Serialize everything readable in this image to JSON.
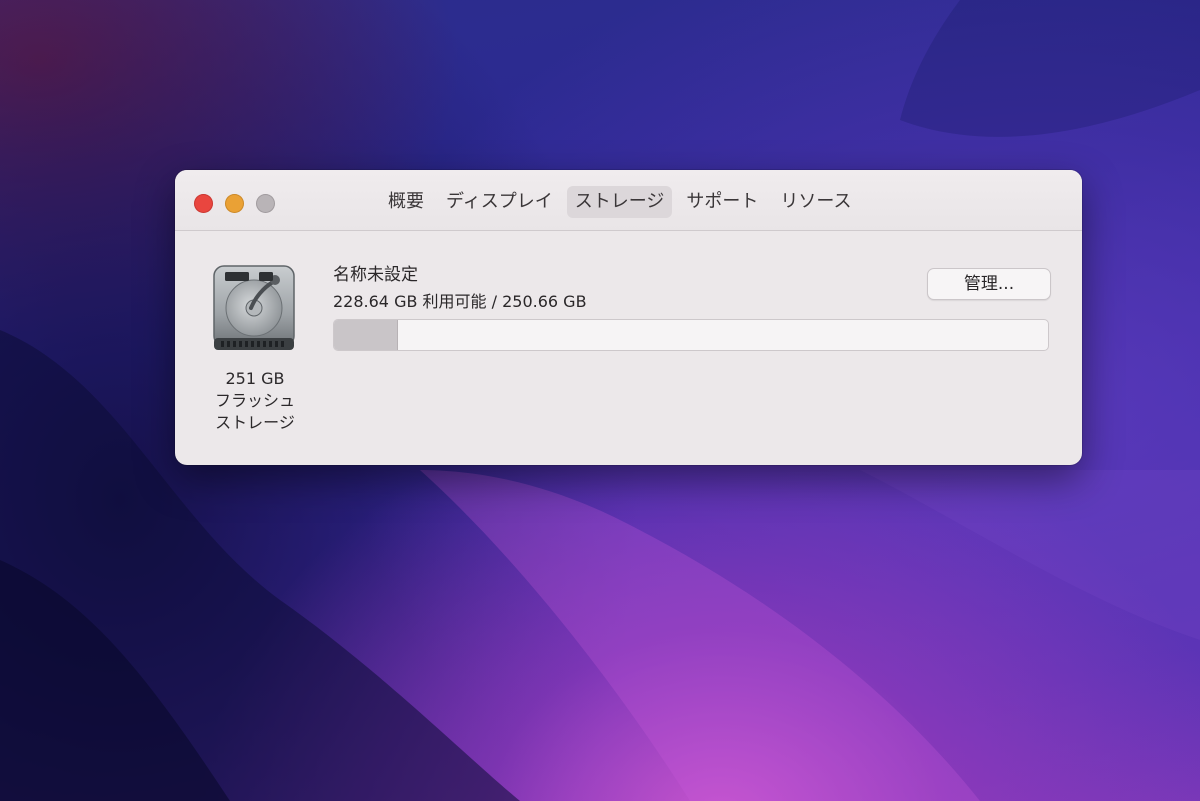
{
  "window": {
    "tabs": [
      {
        "label": "概要",
        "selected": false
      },
      {
        "label": "ディスプレイ",
        "selected": false
      },
      {
        "label": "ストレージ",
        "selected": true
      },
      {
        "label": "サポート",
        "selected": false
      },
      {
        "label": "リソース",
        "selected": false
      }
    ]
  },
  "storage": {
    "drive_icon": "hard-drive-icon",
    "capacity_label": "251 GB",
    "type_line1": "フラッシュ",
    "type_line2": "ストレージ",
    "volume_name": "名称未設定",
    "availability": "228.64 GB 利用可能 / 250.66 GB",
    "used_fraction": 0.088,
    "manage_button": "管理..."
  },
  "colors": {
    "close": "#e9463f",
    "minimize": "#eaa135",
    "zoom": "#b9b4b7"
  }
}
